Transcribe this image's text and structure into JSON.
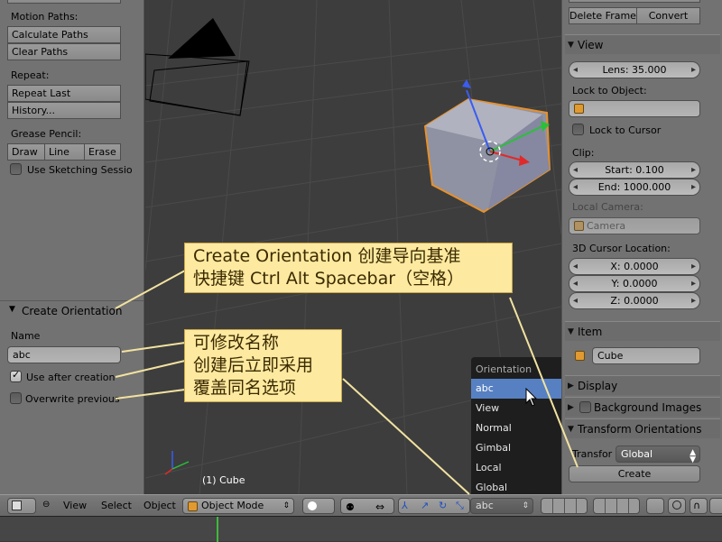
{
  "left_panel": {
    "motion_paths_label": "Motion Paths:",
    "calculate_paths": "Calculate Paths",
    "clear_paths": "Clear Paths",
    "repeat_label": "Repeat:",
    "repeat_last": "Repeat Last",
    "history": "History...",
    "grease_pencil_label": "Grease Pencil:",
    "draw": "Draw",
    "line": "Line",
    "erase": "Erase",
    "use_sketching": "Use Sketching Sessio",
    "create_orientation_title": "Create Orientation",
    "name_label": "Name",
    "name_value": "abc",
    "use_after_creation": "Use after creation",
    "use_after_creation_checked": true,
    "overwrite_previous": "Overwrite previous",
    "overwrite_previous_checked": false
  },
  "viewport": {
    "object_label": "(1) Cube"
  },
  "right_panel": {
    "delete_frame": "Delete Frame",
    "convert": "Convert",
    "view_title": "View",
    "lens": "Lens: 35.000",
    "lock_to_object_label": "Lock to Object:",
    "lock_to_cursor": "Lock to Cursor",
    "clip_label": "Clip:",
    "clip_start": "Start: 0.100",
    "clip_end": "End: 1000.000",
    "local_camera_label": "Local Camera:",
    "local_camera_value": "Camera",
    "cursor_location_label": "3D Cursor Location:",
    "cursor_x": "X: 0.0000",
    "cursor_y": "Y: 0.0000",
    "cursor_z": "Z: 0.0000",
    "item_title": "Item",
    "item_name": "Cube",
    "display_title": "Display",
    "background_images_title": "Background Images",
    "transform_orientations_title": "Transform Orientations",
    "transform_label": "Transfor",
    "transform_value": "Global",
    "create_button": "Create"
  },
  "orientation_menu": {
    "title": "Orientation",
    "items": [
      "abc",
      "View",
      "Normal",
      "Gimbal",
      "Local",
      "Global"
    ],
    "selected": "abc"
  },
  "header": {
    "view": "View",
    "select": "Select",
    "object": "Object",
    "mode": "Object Mode",
    "orientation_value": "abc"
  },
  "callouts": {
    "c1_line1": "Create Orientation 创建导向基准",
    "c1_line2": "快捷键 Ctrl Alt Spacebar（空格）",
    "c2_line1": "可修改名称",
    "c2_line2": "创建后立即采用",
    "c2_line3": "覆盖同名选项"
  },
  "colors": {
    "selection_blue": "#5680c2",
    "callout_bg": "#fde9a0",
    "object_orange": "#e8902a"
  }
}
